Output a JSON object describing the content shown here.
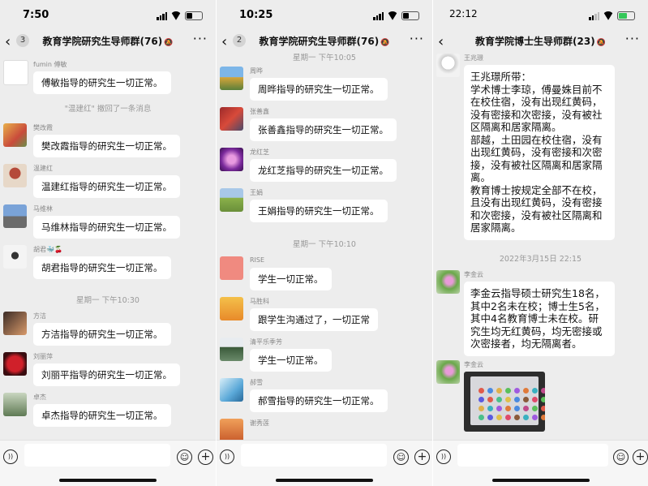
{
  "panel1": {
    "time": "7:50",
    "badge": "3",
    "title": "教育学院研究生导师群(76)",
    "items": [
      {
        "kind": "msg",
        "name": "fumin 傅敏",
        "text": "傅敏指导的研究生一切正常。"
      },
      {
        "kind": "sys",
        "text": "\"温建红\" 撤回了一条消息"
      },
      {
        "kind": "msg",
        "name": "樊改霞",
        "text": "樊改霞指导的研究生一切正常。"
      },
      {
        "kind": "msg",
        "name": "温建红",
        "text": "温建红指导的研究生一切正常。"
      },
      {
        "kind": "msg",
        "name": "马维林",
        "text": "马维林指导的研究生一切正常。"
      },
      {
        "kind": "msg",
        "name": "胡君🐳🍒",
        "text": "胡君指导的研究生一切正常。"
      },
      {
        "kind": "sys",
        "text": "星期一 下午10:30"
      },
      {
        "kind": "msg",
        "name": "方洁",
        "text": "方洁指导的研究生一切正常。"
      },
      {
        "kind": "msg",
        "name": "刘丽萍",
        "text": "刘丽平指导的研究生一切正常。"
      },
      {
        "kind": "msg",
        "name": "卓杰",
        "text": "卓杰指导的研究生一切正常。"
      }
    ]
  },
  "panel2": {
    "time": "10:25",
    "badge": "2",
    "title": "教育学院研究生导师群(76)",
    "items": [
      {
        "kind": "sys",
        "text": "星期一 下午10:05"
      },
      {
        "kind": "msg",
        "name": "周晔",
        "text": "周晔指导的研究生一切正常。"
      },
      {
        "kind": "msg",
        "name": "张善鑫",
        "text": "张善鑫指导的研究生一切正常。"
      },
      {
        "kind": "msg",
        "name": "龙红芝",
        "text": "龙红芝指导的研究生一切正常。"
      },
      {
        "kind": "msg",
        "name": "王娟",
        "text": "王娟指导的研究生一切正常。"
      },
      {
        "kind": "sys",
        "text": "星期一 下午10:10"
      },
      {
        "kind": "msg",
        "name": "RISE",
        "text": "学生一切正常。"
      },
      {
        "kind": "msg",
        "name": "马胜科",
        "text": "跟学生沟通过了，一切正常"
      },
      {
        "kind": "msg",
        "name": "清平乐季芳",
        "text": "学生一切正常。"
      },
      {
        "kind": "msg",
        "name": "郝雪",
        "text": "郝雪指导的研究生一切正常。"
      },
      {
        "kind": "msg",
        "name": "谢秀莲",
        "text": ""
      }
    ]
  },
  "panel3": {
    "time": "22:12",
    "title": "教育学院博士生导师群(23)",
    "items": [
      {
        "kind": "msg",
        "name": "王兆璟",
        "lines": [
          "王兆璟所带：",
          "学术博士李琼，傅曼姝目前不在校住宿，没有出现红黄码，没有密接和次密接，没有被社区隔离和居家隔离。",
          "部越，土田园在校住宿，没有出现红黄码，没有密接和次密接，没有被社区隔离和居家隔离。",
          "教育博士按规定全部不在校，且没有出现红黄码，没有密接和次密接，没有被社区隔离和居家隔离。"
        ]
      },
      {
        "kind": "sys",
        "text": "2022年3月15日 22:15"
      },
      {
        "kind": "msg",
        "name": "李金云",
        "lines": [
          "李金云指导硕士研究生18名，其中2名未在校；博士生5名，其中4名教育博士未在校。研究生均无红黄码，均无密接或次密接者，均无隔离者。"
        ]
      },
      {
        "kind": "img",
        "name": "李金云"
      }
    ]
  },
  "icons": {
    "back": "chevron-left-icon",
    "mute": "bell-off-icon",
    "more": "more-icon",
    "voice": "voice-icon",
    "emoji": "emoji-icon",
    "plus": "plus-icon"
  },
  "glyphs": {
    "back": "‹",
    "mute": "🔕",
    "more": "···",
    "voice": "))",
    "emoji": "☺",
    "plus": "+"
  }
}
